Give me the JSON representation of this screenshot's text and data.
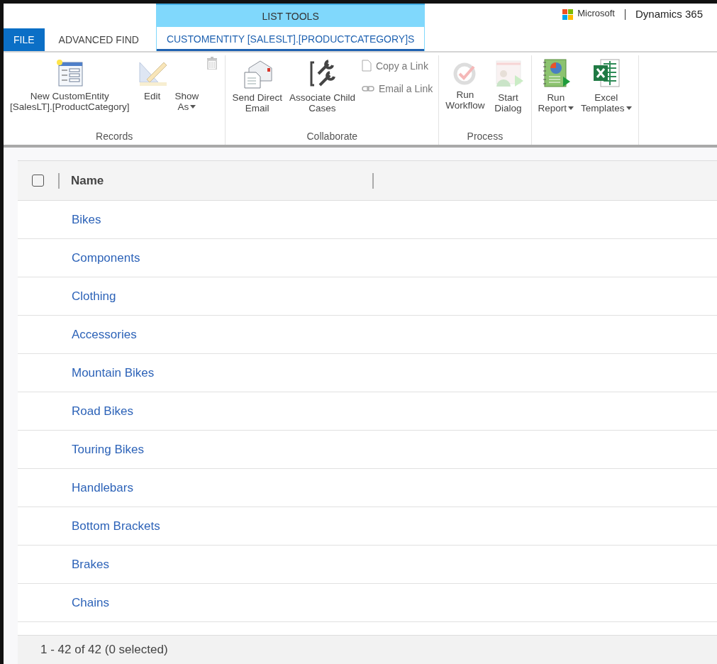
{
  "brand": {
    "company": "Microsoft",
    "product": "Dynamics 365"
  },
  "contextual_tab_group": {
    "label": "LIST TOOLS"
  },
  "tabs": [
    {
      "label": "FILE",
      "kind": "file",
      "selected": false
    },
    {
      "label": "ADVANCED FIND",
      "kind": "plain",
      "selected": false
    },
    {
      "label": "CUSTOMENTITY [SALESLT].[PRODUCTCATEGORY]S",
      "kind": "contextual",
      "selected": true
    }
  ],
  "ribbon_groups": [
    {
      "label": "Records",
      "items": [
        {
          "kind": "large",
          "lines": [
            "New CustomEntity",
            "[SalesLT].[ProductCategory]"
          ],
          "dropdown": false,
          "disabled": false
        },
        {
          "kind": "large",
          "lines": [
            "Edit"
          ],
          "dropdown": false,
          "disabled": true
        },
        {
          "kind": "large",
          "lines": [
            "Show",
            "As"
          ],
          "dropdown": true,
          "disabled": false
        },
        {
          "kind": "icon",
          "disabled": true
        }
      ]
    },
    {
      "label": "Collaborate",
      "items": [
        {
          "kind": "large",
          "lines": [
            "Send Direct",
            "Email"
          ],
          "dropdown": false,
          "disabled": false
        },
        {
          "kind": "large",
          "lines": [
            "Associate Child",
            "Cases"
          ],
          "dropdown": false,
          "disabled": false
        },
        {
          "kind": "small",
          "lines": [
            "Copy a Link"
          ],
          "disabled": true
        },
        {
          "kind": "small",
          "lines": [
            "Email a Link"
          ],
          "disabled": true
        }
      ]
    },
    {
      "label": "Process",
      "items": [
        {
          "kind": "large",
          "lines": [
            "Run",
            "Workflow"
          ],
          "dropdown": false,
          "disabled": true
        },
        {
          "kind": "large",
          "lines": [
            "Start",
            "Dialog"
          ],
          "dropdown": false,
          "disabled": true
        }
      ]
    },
    {
      "items": [
        {
          "kind": "large",
          "lines": [
            "Run",
            "Report"
          ],
          "dropdown": true,
          "disabled": false
        },
        {
          "kind": "large",
          "lines": [
            "Excel",
            "Templates"
          ],
          "dropdown": true,
          "disabled": false
        }
      ]
    }
  ],
  "grid": {
    "select_all_checked": false,
    "columns": [
      "Name"
    ],
    "rows": [
      {
        "name": "Bikes",
        "selected": false
      },
      {
        "name": "Components",
        "selected": false
      },
      {
        "name": "Clothing",
        "selected": false
      },
      {
        "name": "Accessories",
        "selected": false
      },
      {
        "name": "Mountain Bikes",
        "selected": false
      },
      {
        "name": "Road Bikes",
        "selected": false
      },
      {
        "name": "Touring Bikes",
        "selected": false
      },
      {
        "name": "Handlebars",
        "selected": false
      },
      {
        "name": "Bottom Brackets",
        "selected": false
      },
      {
        "name": "Brakes",
        "selected": false
      },
      {
        "name": "Chains",
        "selected": false
      }
    ],
    "status": "1 - 42 of 42 (0 selected)"
  }
}
